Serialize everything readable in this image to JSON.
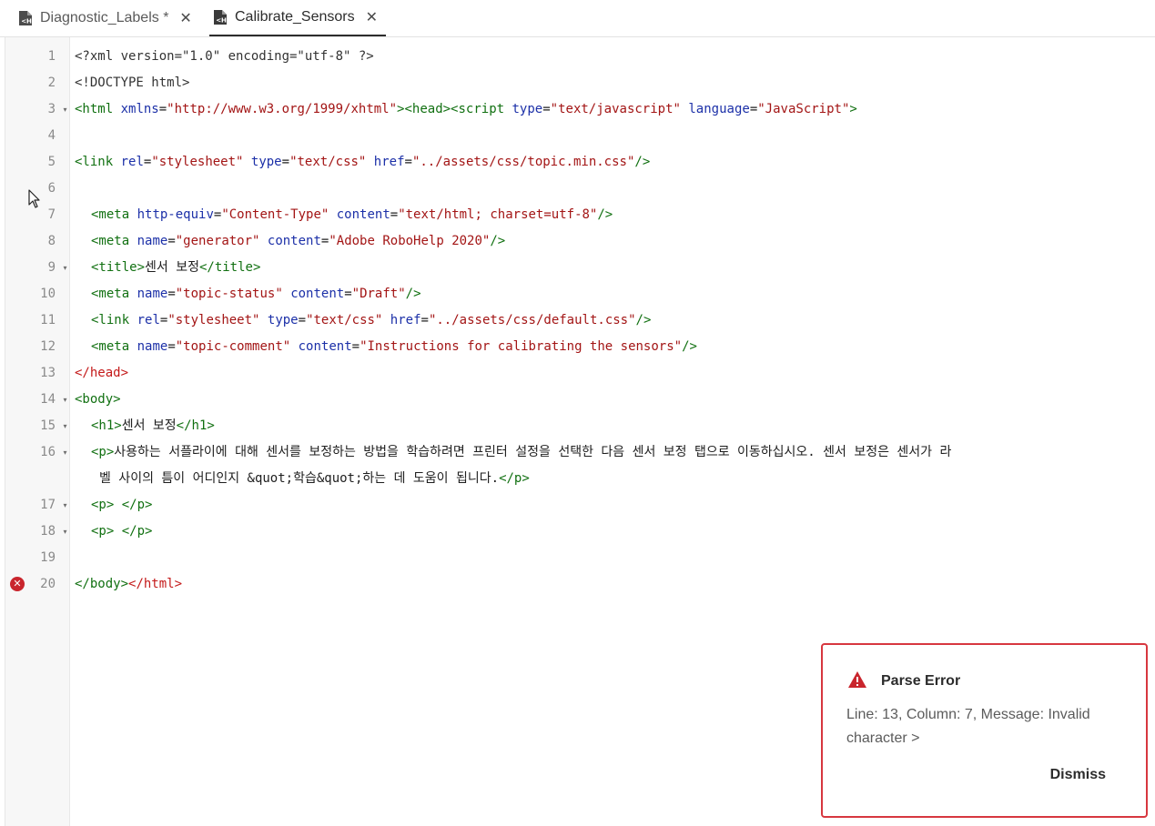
{
  "tabs": [
    {
      "label": "Diagnostic_Labels *",
      "icon": "html-file-icon",
      "close": "✕",
      "active": false
    },
    {
      "label": "Calibrate_Sensors",
      "icon": "html-file-icon",
      "close": "✕",
      "active": true
    }
  ],
  "editor": {
    "lines": [
      {
        "n": "1"
      },
      {
        "n": "2"
      },
      {
        "n": "3"
      },
      {
        "n": "4"
      },
      {
        "n": "5"
      },
      {
        "n": "6"
      },
      {
        "n": "7"
      },
      {
        "n": "8"
      },
      {
        "n": "9"
      },
      {
        "n": "10"
      },
      {
        "n": "11"
      },
      {
        "n": "12"
      },
      {
        "n": "13"
      },
      {
        "n": "14"
      },
      {
        "n": "15"
      },
      {
        "n": "16"
      },
      {
        "n": "17"
      },
      {
        "n": "18"
      },
      {
        "n": "19"
      },
      {
        "n": "20"
      }
    ],
    "fold_glyph": "▾",
    "error_glyph": "✕",
    "code": {
      "l1": "<?xml version=\"1.0\" encoding=\"utf-8\" ?>",
      "l2": "<!DOCTYPE html>",
      "l3_a": "<html",
      "l3_b": " xmlns",
      "l3_c": "=",
      "l3_d": "\"http://www.w3.org/1999/xhtml\"",
      "l3_e": "><head><script",
      "l3_f": " type",
      "l3_g": "=",
      "l3_h": "\"text/javascript\"",
      "l3_i": " language",
      "l3_j": "=",
      "l3_k": "\"JavaScript\"",
      "l3_l": ">",
      "l5_a": "<link",
      "l5_b": " rel",
      "l5_c": "=",
      "l5_d": "\"stylesheet\"",
      "l5_e": " type",
      "l5_f": "=",
      "l5_g": "\"text/css\"",
      "l5_h": " href",
      "l5_i": "=",
      "l5_j": "\"../assets/css/topic.min.css\"",
      "l5_k": "/>",
      "l7_a": "<meta",
      "l7_b": " http-equiv",
      "l7_c": "=",
      "l7_d": "\"Content-Type\"",
      "l7_e": " content",
      "l7_f": "=",
      "l7_g": "\"text/html; charset=utf-8\"",
      "l7_h": "/>",
      "l8_a": "<meta",
      "l8_b": " name",
      "l8_c": "=",
      "l8_d": "\"generator\"",
      "l8_e": " content",
      "l8_f": "=",
      "l8_g": "\"Adobe RoboHelp 2020\"",
      "l8_h": "/>",
      "l9_a": "<title>",
      "l9_b": "센서 보정",
      "l9_c": "</title>",
      "l10_a": "<meta",
      "l10_b": " name",
      "l10_c": "=",
      "l10_d": "\"topic-status\"",
      "l10_e": " content",
      "l10_f": "=",
      "l10_g": "\"Draft\"",
      "l10_h": "/>",
      "l11_a": "<link",
      "l11_b": " rel",
      "l11_c": "=",
      "l11_d": "\"stylesheet\"",
      "l11_e": " type",
      "l11_f": "=",
      "l11_g": "\"text/css\"",
      "l11_h": " href",
      "l11_i": "=",
      "l11_j": "\"../assets/css/default.css\"",
      "l11_k": "/>",
      "l12_a": "<meta",
      "l12_b": " name",
      "l12_c": "=",
      "l12_d": "\"topic-comment\"",
      "l12_e": " content",
      "l12_f": "=",
      "l12_g": "\"Instructions for calibrating the sensors\"",
      "l12_h": "/>",
      "l13": "</head>",
      "l14": "<body>",
      "l15_a": "<h1>",
      "l15_b": "센서 보정",
      "l15_c": "</h1>",
      "l16_a": "<p>",
      "l16_b": "사용하는 서플라이에 대해 센서를 보정하는 방법을 학습하려면 프린터 설정을 선택한 다음 센서 보정 탭으로 이동하십시오. 센서 보정은 센서가 라",
      "l16_c": "벨 사이의 틈이 어디인지 &quot;학습&quot;하는 데 도움이 됩니다.",
      "l16_d": "</p>",
      "l17": "<p> </p>",
      "l18": "<p> </p>",
      "l20_a": "</body>",
      "l20_b": "</html>"
    }
  },
  "toast": {
    "title": "Parse Error",
    "message": "Line: 13, Column: 7, Message: Invalid character >",
    "dismiss": "Dismiss",
    "icon": "alert-triangle-icon",
    "border_color": "#d7373f"
  },
  "colors": {
    "tag": "#117011",
    "attr": "#1c30a8",
    "value": "#a31515",
    "error_tag": "#c41a1a"
  }
}
